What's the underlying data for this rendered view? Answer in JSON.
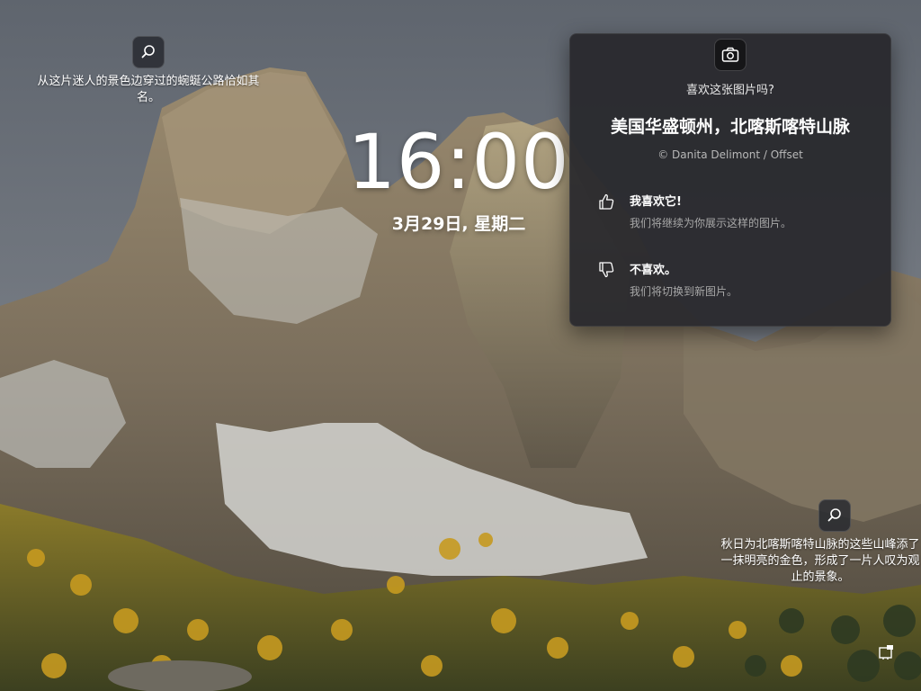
{
  "lock_screen": {
    "time": "16:00",
    "date": "3月29日, 星期二"
  },
  "hotspots": {
    "left": {
      "icon": "magnifier-icon",
      "text": "从这片迷人的景色边穿过的蜿蜒公路恰如其名。"
    },
    "right": {
      "icon": "magnifier-icon",
      "text": "秋日为北喀斯喀特山脉的这些山峰添了一抹明亮的金色，形成了一片人叹为观止的景象。"
    }
  },
  "flyout": {
    "camera_icon": "camera-icon",
    "question": "喜欢这张图片吗?",
    "title": "美国华盛顿州，北喀斯喀特山脉",
    "credit": "© Danita Delimont / Offset",
    "like": {
      "icon": "thumbs-up-icon",
      "title": "我喜欢它!",
      "description": "我们将继续为你展示这样的图片。"
    },
    "dislike": {
      "icon": "thumbs-down-icon",
      "title": "不喜欢。",
      "description": "我们将切换到新图片。"
    }
  },
  "colors": {
    "flyout_bg": "#2a2a2e",
    "text_primary": "#ffffff",
    "text_secondary": "#a8a8a8"
  },
  "corner_icon": "network-icon"
}
